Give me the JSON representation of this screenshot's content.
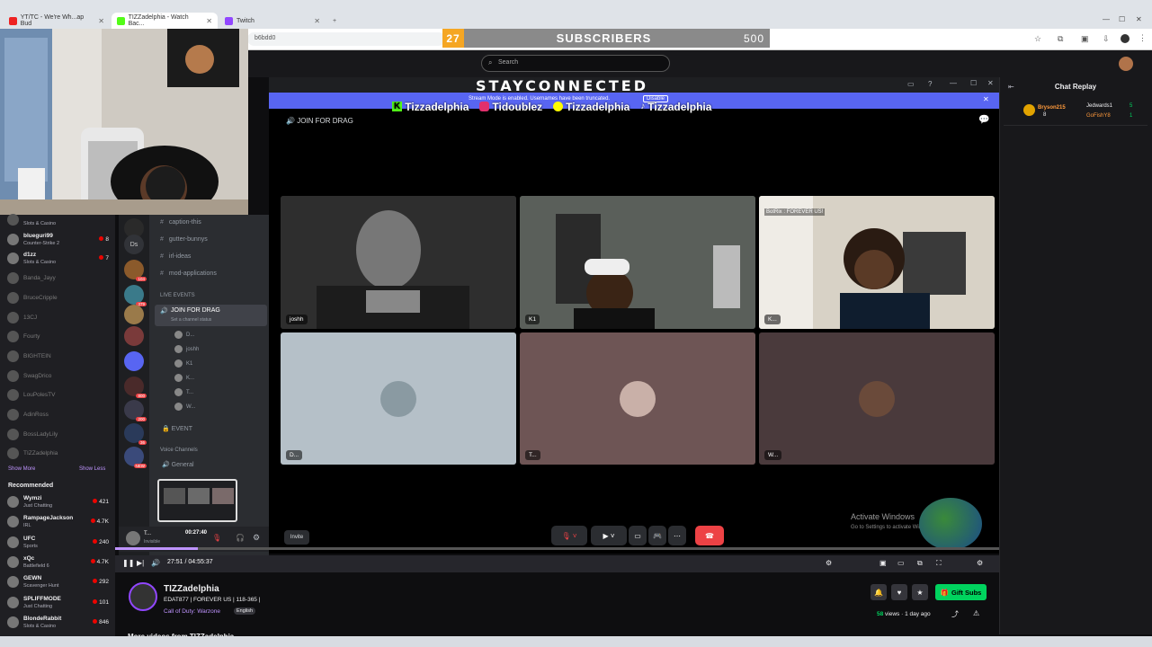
{
  "browser": {
    "tabs": [
      {
        "label": "YT/TC - We're Wh...ap Bud"
      },
      {
        "label": "TIZZadelphia - Watch Bac..."
      },
      {
        "label": "Twitch"
      }
    ],
    "url": "b6bdd0"
  },
  "sub_goal": {
    "count": "27",
    "label": "SUBSCRIBERS",
    "goal": "500"
  },
  "search": {
    "placeholder": "Search"
  },
  "twitch_sidebar": {
    "channels": [
      {
        "name": "",
        "game": "Slots & Casino",
        "viewers": "",
        "live": false
      },
      {
        "name": "blueguri99",
        "game": "Counter-Strike 2",
        "viewers": "8",
        "live": true
      },
      {
        "name": "d1zz",
        "game": "Slots & Casino",
        "viewers": "7",
        "live": true
      },
      {
        "name": "Banda_Jayy",
        "game": "",
        "viewers": "",
        "live": false
      },
      {
        "name": "BruceCripple",
        "game": "",
        "viewers": "",
        "live": false
      },
      {
        "name": "13CJ",
        "game": "",
        "viewers": "",
        "live": false
      },
      {
        "name": "Fourty",
        "game": "",
        "viewers": "",
        "live": false
      },
      {
        "name": "BIGHTEIN",
        "game": "",
        "viewers": "",
        "live": false
      },
      {
        "name": "SwagDrico",
        "game": "",
        "viewers": "",
        "live": false
      },
      {
        "name": "LouPolesTV",
        "game": "",
        "viewers": "",
        "live": false
      },
      {
        "name": "AdinRoss",
        "game": "",
        "viewers": "",
        "live": false
      },
      {
        "name": "BossLadyLily",
        "game": "",
        "viewers": "",
        "live": false
      },
      {
        "name": "TIZZadelphia",
        "game": "",
        "viewers": "",
        "live": false
      }
    ],
    "show_more": "Show More",
    "show_less": "Show Less",
    "recommended_title": "Recommended",
    "recommended": [
      {
        "name": "Wymzi",
        "game": "Just Chatting",
        "viewers": "421"
      },
      {
        "name": "RampageJackson",
        "game": "IRL",
        "viewers": "4.7K"
      },
      {
        "name": "UFC",
        "game": "Sports",
        "viewers": "240"
      },
      {
        "name": "xQc",
        "game": "Battlefield 6",
        "viewers": "4.7K"
      },
      {
        "name": "GEWN",
        "game": "Scavenger Hunt",
        "viewers": "292"
      },
      {
        "name": "SPLIFFMODE",
        "game": "Just Chatting",
        "viewers": "101"
      },
      {
        "name": "BlondeRabbit",
        "game": "Slots & Casino",
        "viewers": "846"
      }
    ]
  },
  "discord": {
    "server_badges": [
      "104",
      "379",
      "800",
      "200",
      "36",
      "NEW"
    ],
    "rail_label": "Ds",
    "channels": [
      "caption-this",
      "gutter-bunnys",
      "irl-ideas",
      "mod-applications"
    ],
    "live_events": "LIVE EVENTS",
    "voice_channel": "JOIN FOR DRAG",
    "voice_status": "Set a channel status",
    "voice_users": [
      "D...",
      "joshh",
      "K1",
      "K...",
      "T...",
      "W..."
    ],
    "event_label": "EVENT",
    "voice_channels_label": "Voice Channels",
    "general_label": "General",
    "user_name": "T...",
    "user_status": "Invisible",
    "elapsed": "00:27:40",
    "call_header": "JOIN FOR DRAG",
    "stay_connected": "STAYCONNECTED",
    "notice": "Stream Mode is enabled. Usernames have been truncated.",
    "notice_btn": "Disable",
    "socials": [
      {
        "platform": "kick",
        "handle": "Tizzadelphia"
      },
      {
        "platform": "instagram",
        "handle": "Tidoublez"
      },
      {
        "platform": "snapchat",
        "handle": "Tizzadelphia"
      },
      {
        "platform": "tiktok",
        "handle": "Tizzadelphia"
      }
    ],
    "tiles": [
      {
        "label": "joshh",
        "bg": "#3a3a3a"
      },
      {
        "label": "K1",
        "bg": "#4a4f4a"
      },
      {
        "label": "K...",
        "bg": "#6a6a66",
        "overlay": "BotRix : FOREVER US!"
      },
      {
        "label": "D...",
        "bg": "#b5c0c8"
      },
      {
        "label": "T...",
        "bg": "#6e5555"
      },
      {
        "label": "W...",
        "bg": "#4a3a3c"
      }
    ],
    "invite": "Invite",
    "activate_title": "Activate Windows",
    "activate_sub": "Go to Settings to activate Windows."
  },
  "player": {
    "time": "27:51 / 04:55:37",
    "progress": 0.094
  },
  "chat": {
    "title": "Chat Replay",
    "leaders": [
      {
        "name": "Bryson215",
        "count": "8"
      },
      {
        "name": "Jedwards1",
        "count": "5"
      },
      {
        "name": "GoFishY8",
        "count": "1"
      }
    ]
  },
  "channel": {
    "name": "TIZZadelphia",
    "title": "EDAT877 | FOREVER US | 118-365 |",
    "game": "Call of Duty: Warzone",
    "language": "English",
    "gift_subs": "Gift Subs",
    "views": "58",
    "views_label": "views",
    "age": "1 day ago",
    "more_videos": "More videos from TIZZadelphia"
  },
  "colors": {
    "twitch_purple": "#9147ff",
    "discord_blurple": "#5865f2",
    "live_red": "#eb0400",
    "gift_green": "#00d35e",
    "sub_orange": "#f5a623"
  }
}
